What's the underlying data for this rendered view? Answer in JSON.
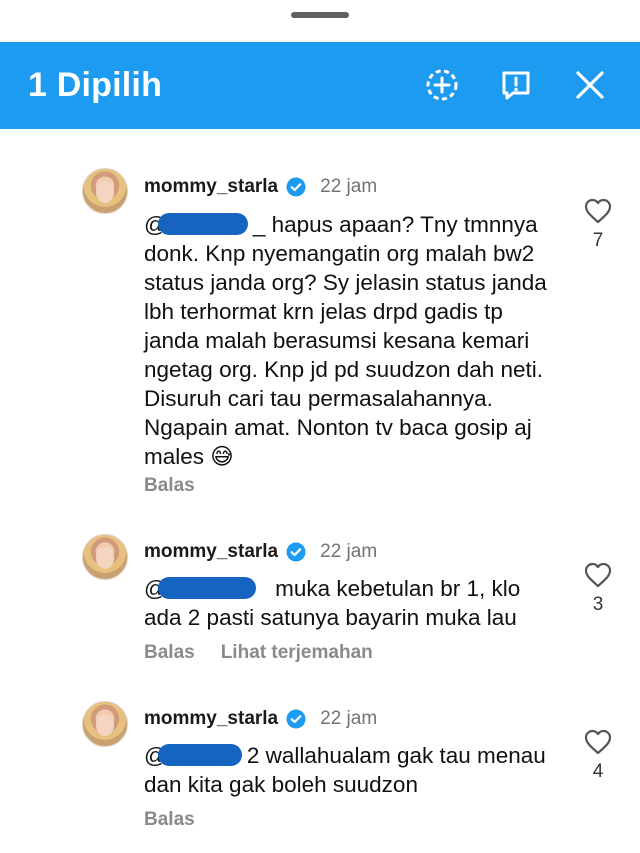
{
  "action_bar": {
    "title": "1 Dipilih",
    "icons": [
      "add-circle-icon",
      "report-icon",
      "close-icon"
    ],
    "accent": "#1d9bf0"
  },
  "comments": [
    {
      "username": "mommy_starla",
      "time": "22 jam",
      "mention_prefix": "@",
      "mention_suffix": "_",
      "text": "hapus apaan? Tny tmnnya donk. Knp nyemangatin org malah bw2 status janda org? Sy jelasin status janda lbh terhormat krn jelas drpd gadis tp janda malah berasumsi kesana kemari ngetag org. Knp jd pd suudzon dah neti. Disuruh cari tau permasalahannya. Ngapain amat. Nonton tv baca gosip aj males 😅",
      "reply_label": "Balas",
      "translate_label": "",
      "likes": "7"
    },
    {
      "username": "mommy_starla",
      "time": "22 jam",
      "mention_prefix": "@",
      "mention_suffix": "",
      "text": "muka kebetulan br 1, klo ada 2 pasti satunya bayarin muka lau",
      "reply_label": "Balas",
      "translate_label": "Lihat terjemahan",
      "likes": "3"
    },
    {
      "username": "mommy_starla",
      "time": "22 jam",
      "mention_prefix": "@",
      "mention_suffix": "2",
      "text": "wallahualam gak tau menau dan kita gak boleh suudzon",
      "reply_label": "Balas",
      "translate_label": "",
      "likes": "4"
    }
  ]
}
